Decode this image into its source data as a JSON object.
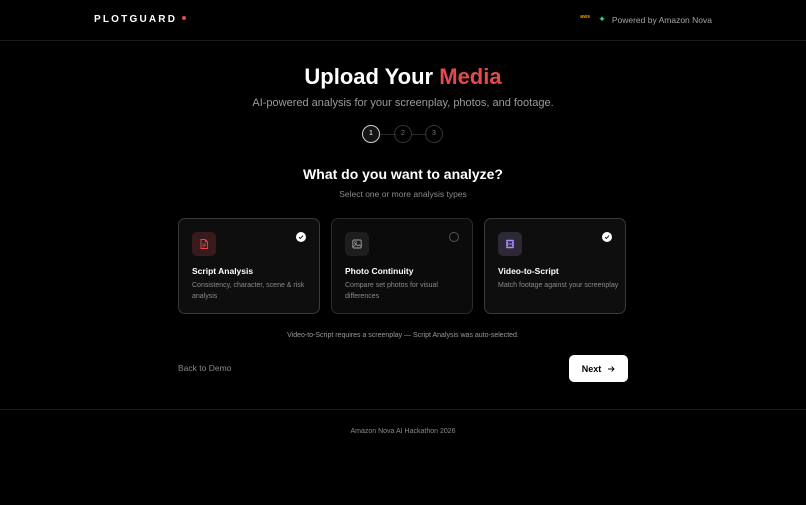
{
  "header": {
    "logo": "PLOTGUARD",
    "aws_label": "aws",
    "powered_by": "Powered by Amazon Nova",
    "icons": [
      "aws-logo",
      "sparkle-icon"
    ]
  },
  "hero": {
    "title_part1": "Upload Your",
    "title_accent": "Media",
    "subtitle": "AI-powered analysis for your screenplay, photos, and footage."
  },
  "stepper": {
    "current_step": 1,
    "steps": [
      "1",
      "2",
      "3"
    ]
  },
  "question": {
    "title": "What do you want to analyze?",
    "subtitle": "Select one or more analysis types"
  },
  "cards": [
    {
      "title": "Script Analysis",
      "description": "Consistency, character, scene & risk analysis",
      "selected": true,
      "icon": "document-icon",
      "icon_color": "#e5484d"
    },
    {
      "title": "Photo Continuity",
      "description": "Compare set photos for visual differences",
      "selected": false,
      "icon": "image-icon",
      "icon_color": "#a3a3a3"
    },
    {
      "title": "Video-to-Script",
      "description": "Match footage against your screenplay",
      "selected": true,
      "icon": "film-icon",
      "icon_color": "#a78bfa"
    }
  ],
  "note": "Video-to-Script requires a screenplay — Script Analysis was auto-selected.",
  "actions": {
    "back_label": "Back to Demo",
    "next_label": "Next"
  },
  "footer": {
    "text": "Amazon Nova AI Hackathon 2026"
  },
  "colors": {
    "accent": "#e5484d",
    "background": "#000000",
    "selected_check": "#ffffff"
  }
}
